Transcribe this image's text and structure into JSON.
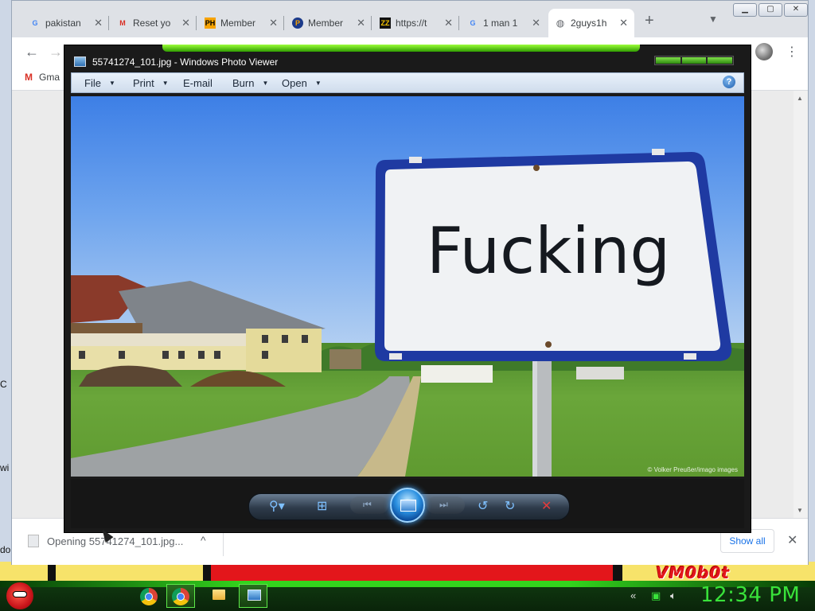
{
  "chrome": {
    "tabs": [
      {
        "label": "pakistan",
        "fav": "G"
      },
      {
        "label": "Reset yo",
        "fav": "M"
      },
      {
        "label": "Member",
        "fav": "PH"
      },
      {
        "label": "Member",
        "fav": "PH"
      },
      {
        "label": "https://t",
        "fav": "ZZ"
      },
      {
        "label": "1 man 1",
        "fav": "G"
      },
      {
        "label": "2guys1h",
        "fav": "globe"
      }
    ],
    "new_tab": "+",
    "bookmark_gmail": "Gma",
    "download_label": "Opening 55741274_101.jpg...",
    "show_all": "Show all"
  },
  "photo_viewer": {
    "title": "55741274_101.jpg - Windows Photo Viewer",
    "menu": {
      "file": "File",
      "print": "Print",
      "email": "E-mail",
      "burn": "Burn",
      "open": "Open"
    },
    "help": "?",
    "sign_text": "Fucking",
    "credit": "© Volker Preußer/imago images"
  },
  "left_fragments": {
    "a": "C",
    "b": "wi",
    "c": "do"
  },
  "desktop": {
    "wallpaper_text": "VM0b0t"
  },
  "taskbar": {
    "clock": "12:34 PM"
  },
  "colors": {
    "taskbar_green": "#39e23a",
    "accent_blue": "#1a73e8"
  }
}
